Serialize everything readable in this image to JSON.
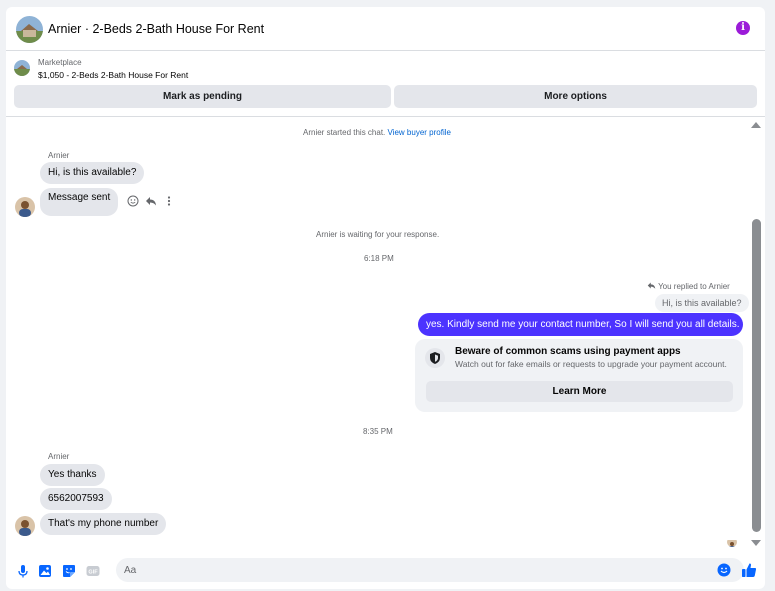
{
  "header": {
    "title": "Arnier · 2-Beds 2-Bath House For Rent",
    "info_icon": "info-icon"
  },
  "listing": {
    "source": "Marketplace",
    "detail": "$1,050 - 2-Beds 2-Bath House For Rent",
    "pending_label": "Mark as pending",
    "more_label": "More options"
  },
  "chat": {
    "started_text": "Arnier started this chat.",
    "view_profile": "View buyer profile",
    "sender_name": "Arnier",
    "msg1": "Hi, is this available?",
    "msg2": "Message sent",
    "waiting_text": "Arnier is waiting for your response.",
    "time1": "6:18 PM",
    "replied_text": "You replied to Arnier",
    "quoted": "Hi, is this available?",
    "reply": "yes. Kindly send me your contact number, So I will send you all details.",
    "scam_title": "Beware of common scams using payment apps",
    "scam_sub": "Watch out for fake emails or requests to upgrade your payment account.",
    "learn_more": "Learn More",
    "time2": "8:35 PM",
    "sender_name2": "Arnier",
    "msg3": "Yes thanks",
    "msg4": "6562007593",
    "msg5": "That's my phone number"
  },
  "composer": {
    "placeholder": "Aa",
    "icons": [
      "microphone-icon",
      "photo-icon",
      "sticker-icon",
      "gif-icon",
      "emoji-icon",
      "thumbs-up-icon"
    ]
  },
  "colors": {
    "accent": "#4c33ff",
    "link": "#0064d1",
    "info": "#9b1bd8",
    "icon_blue": "#0866ff"
  }
}
